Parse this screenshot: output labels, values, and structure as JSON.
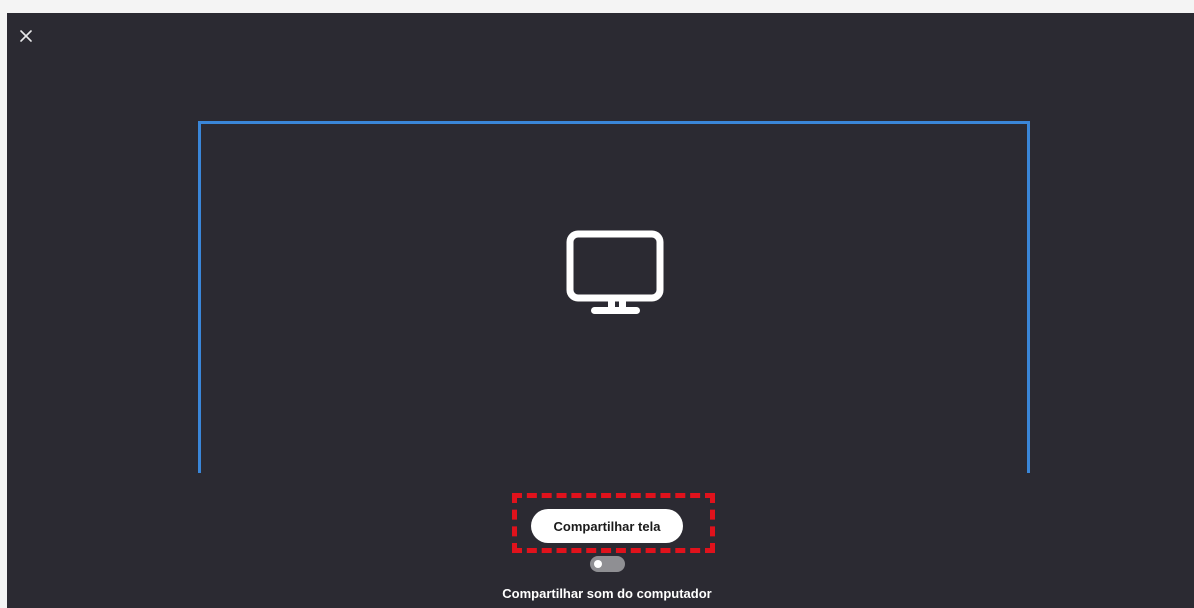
{
  "dialog": {
    "close_icon": "close-icon",
    "preview_icon": "monitor-icon",
    "share_button_label": "Compartilhar tela",
    "share_sound_label": "Compartilhar som do computador",
    "share_sound_enabled": false
  },
  "colors": {
    "background": "#2b2a32",
    "frame_border": "#3a86d8",
    "highlight": "#e0121c",
    "button_bg": "#ffffff",
    "toggle_off": "#8f8f93"
  }
}
